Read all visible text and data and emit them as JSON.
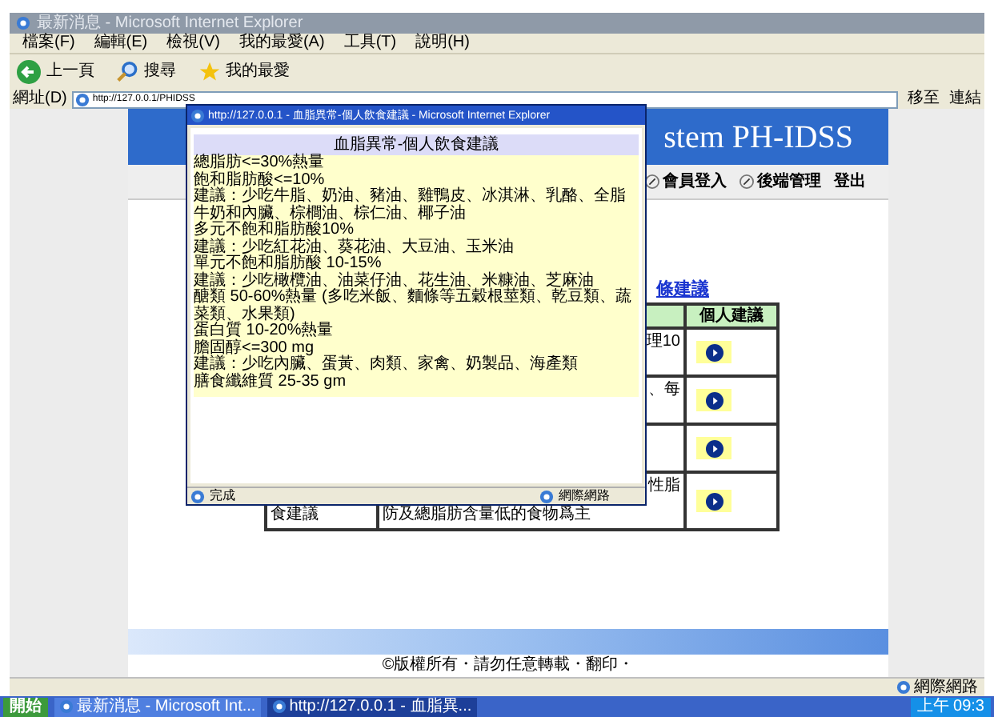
{
  "browser": {
    "title": "最新消息 - Microsoft Internet Explorer",
    "menu": [
      "檔案(F)",
      "編輯(E)",
      "檢視(V)",
      "我的最愛(A)",
      "工具(T)",
      "說明(H)"
    ],
    "toolbar": [
      {
        "kind": "back",
        "label": "上一頁"
      },
      {
        "kind": "search",
        "label": "搜尋"
      },
      {
        "kind": "favorites",
        "label": "我的最愛"
      }
    ],
    "address_label": "網址(D)",
    "address": "http://127.0.0.1/PHIDSS",
    "go_label": "移至",
    "links_label": "連結",
    "status_zone": "網際網路"
  },
  "page": {
    "banner": "stem PH-IDSS",
    "nav": [
      {
        "label": "會員登入",
        "icon": true
      },
      {
        "label": "後端管理",
        "icon": true
      },
      {
        "label": "登出",
        "icon": false
      }
    ],
    "link": "條建議",
    "table_header": "個人建議",
    "rows": [
      {
        "col_1": "",
        "col_2": "理10"
      },
      {
        "col_1": "",
        "col_2": "、每"
      },
      {
        "col_1": "",
        "col_2": ""
      },
      {
        "col_1": "食建議",
        "col_2": "性脂",
        "col_2_more": "防及總脂肪含量低的食物爲主"
      }
    ],
    "footer": "©版權所有・請勿任意轉載・翻印・"
  },
  "popup": {
    "title": "http://127.0.0.1 - 血脂異常-個人飲食建議 - Microsoft Internet Explorer",
    "heading": "血脂異常-個人飲食建議",
    "lines": [
      "總脂肪<=30%熱量",
      "飽和脂肪酸<=10%",
      "建議：少吃牛脂、奶油、豬油、雞鴨皮、冰淇淋、乳酪、全脂",
      "牛奶和內臟、棕櫚油、棕仁油、椰子油",
      "多元不飽和脂肪酸10%",
      "建議：少吃紅花油、葵花油、大豆油、玉米油",
      "單元不飽和脂肪酸 10-15%",
      "建議：少吃橄欖油、油菜仔油、花生油、米糠油、芝麻油",
      "醣類 50-60%熱量 (多吃米飯、麵條等五穀根莖類、乾豆類、蔬",
      "菜類、水果類)",
      "蛋白質 10-20%熱量",
      "膽固醇<=300 mg",
      "建議：少吃內臟、蛋黃、肉類、家禽、奶製品、海產類",
      "膳食纖維質 25-35 gm"
    ],
    "status": "完成",
    "zone": "網際網路"
  },
  "taskbar": {
    "start": "開始",
    "tasks": [
      {
        "label": "最新消息 - Microsoft Int...",
        "selected": false
      },
      {
        "label": "http://127.0.0.1 - 血脂異...",
        "selected": true
      }
    ],
    "clock": "上午 09:3"
  }
}
